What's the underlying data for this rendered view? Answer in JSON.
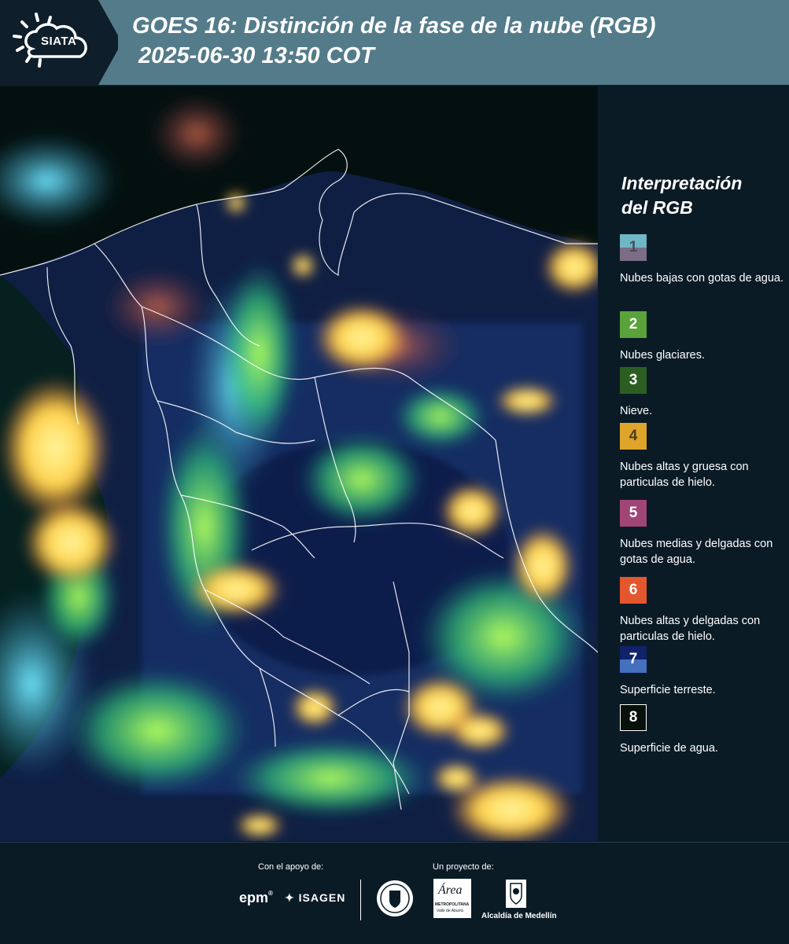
{
  "header": {
    "logo_text": "SIATA",
    "title_line1": "GOES 16: Distinción de la fase de la nube (RGB)",
    "title_line2": " 2025-06-30 13:50 COT"
  },
  "legend": {
    "title_line1": "Interpretación",
    "title_line2": "del RGB",
    "items": [
      {
        "number": "1",
        "label": "Nubes bajas con gotas de agua.",
        "color_top": "#6fb6c6",
        "color_bottom": "#7b6c87",
        "text_color": "#4a4a5a"
      },
      {
        "number": "2",
        "label": "Nubes glaciares.",
        "color_top": "#5aa23a",
        "color_bottom": "#5aa23a",
        "text_color": "#ffffff"
      },
      {
        "number": "3",
        "label": "Nieve.",
        "color_top": "#2c5e22",
        "color_bottom": "#2c5e22",
        "text_color": "#ffffff"
      },
      {
        "number": "4",
        "label": "Nubes altas y gruesa con particulas de hielo.",
        "color_top": "#dfa52a",
        "color_bottom": "#dfa52a",
        "text_color": "#4a3d22"
      },
      {
        "number": "5",
        "label": "Nubes medias y delgadas con gotas de agua.",
        "color_top": "#a14576",
        "color_bottom": "#a14576",
        "text_color": "#ffffff"
      },
      {
        "number": "6",
        "label": "Nubes altas y delgadas con particulas de hielo.",
        "color_top": "#e4572e",
        "color_bottom": "#e4572e",
        "text_color": "#ffffff"
      },
      {
        "number": "7",
        "label": "Superficie terreste.",
        "color_top": "#10226a",
        "color_bottom": "#4470bd",
        "text_color": "#ffffff"
      },
      {
        "number": "8",
        "label": "Superficie de agua.",
        "color_top": "#05110a",
        "color_bottom": "#05110a",
        "text_color": "#ffffff"
      }
    ]
  },
  "footer": {
    "support_label": "Con el apoyo de:",
    "project_label": "Un proyecto de:",
    "sponsor_epm": "epm",
    "sponsor_isagen": "ISAGEN",
    "org_metro": "Área",
    "org_metro_sub": "METROPOLITANA",
    "org_metro_sub2": "Valle de Aburrá",
    "org_alcaldia": "Alcaldía de Medellín"
  }
}
